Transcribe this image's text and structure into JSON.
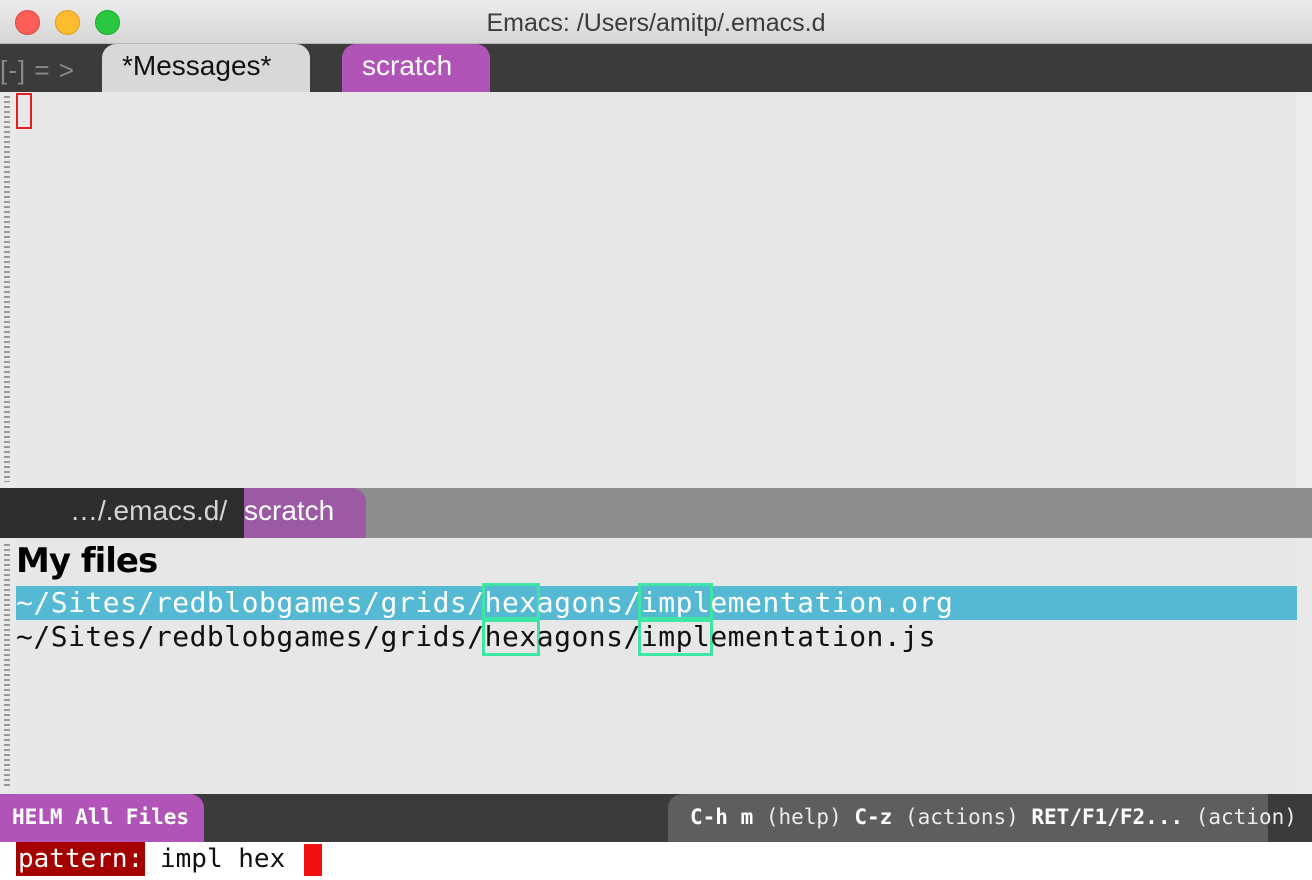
{
  "window": {
    "title": "Emacs: /Users/amitp/.emacs.d"
  },
  "tabbar": {
    "nav": "[-] = >",
    "tabs": [
      {
        "label": "*Messages*",
        "active": false
      },
      {
        "label": "scratch",
        "active": true
      }
    ]
  },
  "modeline_upper": {
    "path": "…/.emacs.d/",
    "buffer": "scratch"
  },
  "helm": {
    "header": "My files",
    "candidates": [
      {
        "prefix": "~/Sites/redblobgames/grids/",
        "m1": "hex",
        "mid": "agons/",
        "m2": "impl",
        "suffix": "ementation.org",
        "selected": true
      },
      {
        "prefix": "~/Sites/redblobgames/grids/",
        "m1": "hex",
        "mid": "agons/",
        "m2": "impl",
        "suffix": "ementation.js",
        "selected": false
      }
    ],
    "source_name": "HELM All Files",
    "help": {
      "k1": "C-h m",
      "d1": " (help) ",
      "k2": "C-z",
      "d2": " (actions) ",
      "k3": "RET/F1/F2...",
      "d3": " (action)"
    }
  },
  "minibuffer": {
    "prompt": "pattern: ",
    "input": "impl hex"
  },
  "colors": {
    "accent": "#b054b8",
    "selection": "#56b9d4",
    "match": "#3ee6a4",
    "prompt_bg": "#a40000"
  }
}
